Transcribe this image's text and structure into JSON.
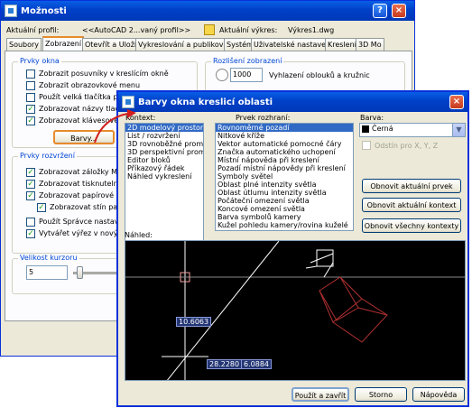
{
  "options": {
    "title": "Možnosti",
    "profile_label": "Aktuální profil:",
    "profile_value": "<<AutoCAD 2...vaný profil>>",
    "drawing_label": "Aktuální výkres:",
    "drawing_value": "Výkres1.dwg",
    "tabs": [
      "Soubory",
      "Zobrazení",
      "Otevřít a Uložit",
      "Vykreslování a publikování",
      "Systém",
      "Uživatelské nastavení",
      "Kreslení",
      "3D Mo"
    ],
    "window_group": {
      "title": "Prvky okna",
      "items": [
        {
          "label": "Zobrazit posuvníky v kreslícím okně",
          "checked": false
        },
        {
          "label": "Zobrazit obrazovkové menu",
          "checked": false
        },
        {
          "label": "Použít velká tlačítka pro p",
          "checked": false
        },
        {
          "label": "Zobrazovat názvy tlačítek",
          "checked": true
        },
        {
          "label": "Zobrazovat klávesové",
          "checked": true
        }
      ],
      "colors_button": "Barvy..."
    },
    "resolution_group": {
      "title": "Rozlišení zobrazení",
      "value": "1000",
      "label": "Vyhlazení oblouků a kružnic"
    },
    "layout_group": {
      "title": "Prvky rozvržení",
      "items": [
        {
          "label": "Zobrazovat záložky Model",
          "checked": true
        },
        {
          "label": "Zobrazovat tisknutelnou o",
          "checked": true
        },
        {
          "label": "Zobrazovat papírové poza",
          "checked": true
        },
        {
          "label": "Zobrazovat stín papír",
          "checked": true
        },
        {
          "label": "Použít Správce nastavení",
          "checked": false
        },
        {
          "label": "Vytvářet výřez v nových r",
          "checked": true
        }
      ]
    },
    "crosshair_group": {
      "title": "Velikost kurzoru",
      "value": "5"
    }
  },
  "colors": {
    "title": "Barvy okna kreslicí oblasti",
    "context_label": "Kontext:",
    "contexts": [
      "2D modelový prostor",
      "List / rozvržení",
      "3D rovnoběžné promítání",
      "3D perspektivní promítání",
      "Editor bloků",
      "Příkazový řádek",
      "Náhled vykreslení"
    ],
    "element_label": "Prvek rozhraní:",
    "elements": [
      "Rovnoměrné pozadí",
      "Nitkové kříže",
      "Vektor automatické pomocné čáry",
      "Značka automatického uchopení",
      "Místní nápověda při kreslení",
      "Pozadí místní nápovědy při kreslení",
      "Symboly světel",
      "Oblast plné intenzity světla",
      "Oblast útlumu intenzity světla",
      "Počáteční omezení světla",
      "Koncové omezení světla",
      "Barva symbolů kamery",
      "Kužel pohledu kamery/rovina kuželé"
    ],
    "color_label": "Barva:",
    "color_value": "Černá",
    "tint_label": "Odstín pro X, Y, Z",
    "restore_item": "Obnovit aktuální prvek",
    "restore_context": "Obnovit aktuální kontext",
    "restore_all": "Obnovit všechny kontexty",
    "preview_label": "Náhled:",
    "preview_readouts": [
      "10.6063",
      "28.2280",
      "6.0884"
    ],
    "apply_close": "Použít a zavřít",
    "cancel": "Storno",
    "help": "Nápověda"
  }
}
